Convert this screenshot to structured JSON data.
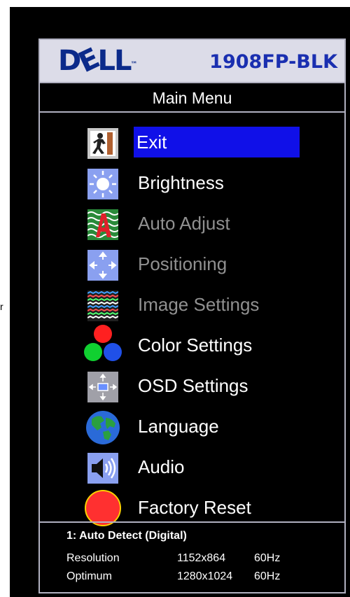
{
  "monitor": {
    "brand": "DELL",
    "brand_tm": "™",
    "model": "1908FP-BLK",
    "stray_text": "r"
  },
  "menu": {
    "title": "Main Menu",
    "items": [
      {
        "label": "Exit",
        "icon": "exit-icon",
        "selected": true,
        "enabled": true
      },
      {
        "label": "Brightness",
        "icon": "brightness-icon",
        "selected": false,
        "enabled": true
      },
      {
        "label": "Auto Adjust",
        "icon": "auto-adjust-icon",
        "selected": false,
        "enabled": false
      },
      {
        "label": "Positioning",
        "icon": "positioning-icon",
        "selected": false,
        "enabled": false
      },
      {
        "label": "Image Settings",
        "icon": "image-settings-icon",
        "selected": false,
        "enabled": false
      },
      {
        "label": "Color Settings",
        "icon": "color-settings-icon",
        "selected": false,
        "enabled": true
      },
      {
        "label": "OSD Settings",
        "icon": "osd-settings-icon",
        "selected": false,
        "enabled": true
      },
      {
        "label": "Language",
        "icon": "globe-icon",
        "selected": false,
        "enabled": true
      },
      {
        "label": "Audio",
        "icon": "speaker-icon",
        "selected": false,
        "enabled": true
      },
      {
        "label": "Factory Reset",
        "icon": "factory-reset-icon",
        "selected": false,
        "enabled": true
      }
    ]
  },
  "info": {
    "input": "1: Auto Detect (Digital)",
    "resolution_label": "Resolution",
    "resolution_value": "1152x864",
    "resolution_hz": "60Hz",
    "optimum_label": "Optimum",
    "optimum_value": "1280x1024",
    "optimum_hz": "60Hz"
  },
  "colors": {
    "selection": "#1010e8",
    "disabled_text": "#909090",
    "header_bg": "#dcdce8",
    "brand_blue": "#0b2a8a"
  }
}
